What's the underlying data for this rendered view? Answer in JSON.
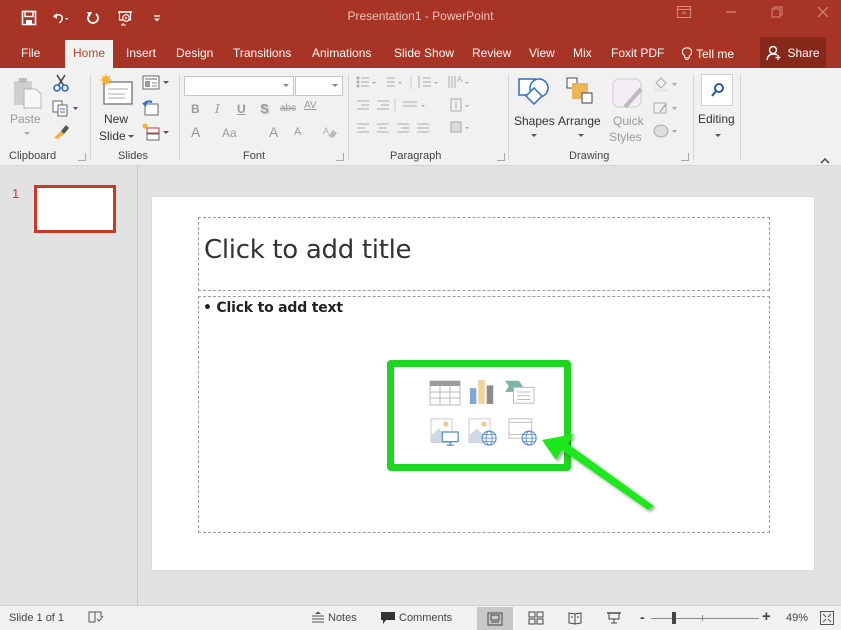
{
  "window": {
    "title": "Presentation1  -  PowerPoint",
    "controls": [
      "ribbon-display-options",
      "minimize",
      "restore",
      "close"
    ]
  },
  "quick_access": [
    "save",
    "undo",
    "redo",
    "start-from-beginning",
    "customize"
  ],
  "tabs": [
    {
      "label": "File"
    },
    {
      "label": "Home",
      "active": true
    },
    {
      "label": "Insert"
    },
    {
      "label": "Design"
    },
    {
      "label": "Transitions"
    },
    {
      "label": "Animations"
    },
    {
      "label": "Slide Show"
    },
    {
      "label": "Review"
    },
    {
      "label": "View"
    },
    {
      "label": "Mix"
    },
    {
      "label": "Foxit PDF"
    },
    {
      "label": "Tell me"
    }
  ],
  "share_label": "Share",
  "ribbon": {
    "clipboard": {
      "label": "Clipboard",
      "paste": "Paste"
    },
    "slides": {
      "label": "Slides",
      "new_slide_1": "New",
      "new_slide_2": "Slide"
    },
    "font": {
      "label": "Font",
      "font_name": "",
      "font_size": "",
      "bold": "B",
      "italic": "I",
      "underline": "U",
      "shadow": "S",
      "strike": "abc",
      "spacing": "AV",
      "color": "A",
      "case": "Aa",
      "grow": "A",
      "shrink": "A"
    },
    "paragraph": {
      "label": "Paragraph"
    },
    "drawing": {
      "label": "Drawing",
      "shapes": "Shapes",
      "arrange": "Arrange",
      "quick_styles_1": "Quick",
      "quick_styles_2": "Styles"
    },
    "editing": {
      "label": "Editing"
    }
  },
  "thumbnails": [
    {
      "number": "1",
      "selected": true
    }
  ],
  "slide": {
    "title_placeholder": "Click to add title",
    "body_placeholder": "• Click to add text",
    "content_icons": [
      "insert-table",
      "insert-chart",
      "insert-smartart",
      "pictures",
      "online-pictures",
      "insert-video"
    ]
  },
  "annotation": {
    "color": "#1ed61e",
    "target": "insert-video"
  },
  "status": {
    "slide_of": "Slide 1 of 1",
    "notes": "Notes",
    "comments": "Comments",
    "zoom_percent": "49%",
    "zoom_value": 49,
    "active_view": "normal"
  },
  "colors": {
    "accent": "#a73424",
    "accent_dark": "#86281a",
    "active_tab_text": "#b7472a"
  }
}
